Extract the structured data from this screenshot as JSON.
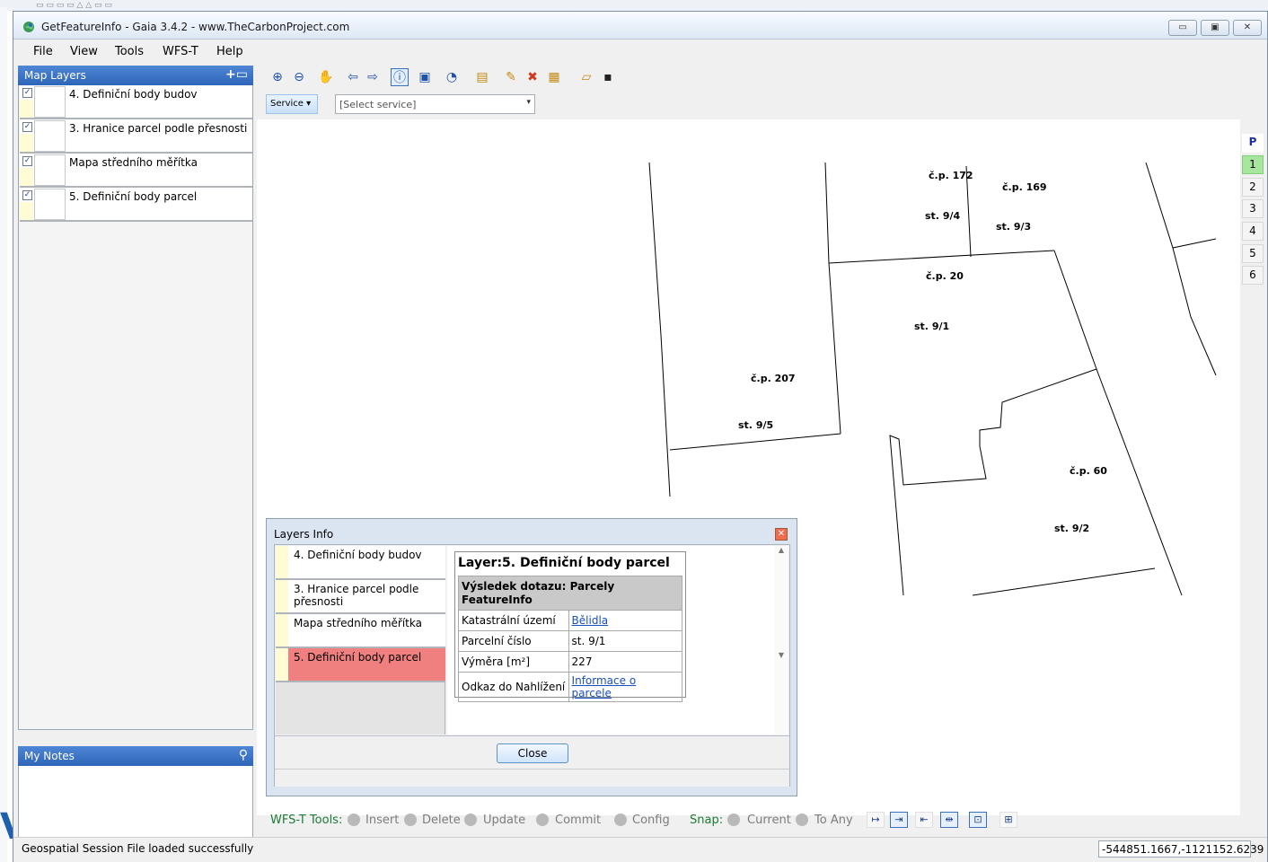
{
  "window": {
    "title": "GetFeatureInfo - Gaia 3.4.2 - www.TheCarbonProject.com",
    "controls": {
      "minimize": "▭",
      "maximize": "▣",
      "close": "✕"
    }
  },
  "menu": [
    "File",
    "View",
    "Tools",
    "WFS-T",
    "Help"
  ],
  "map_layers": {
    "title": "Map Layers",
    "add_icon": "add-layer-icon",
    "items": [
      {
        "label": "4. Definiční body budov",
        "checked": true
      },
      {
        "label": "3. Hranice parcel podle přesnosti",
        "checked": true
      },
      {
        "label": "Mapa středního měřítka",
        "checked": true
      },
      {
        "label": "5. Definiční body parcel",
        "checked": true
      }
    ]
  },
  "notes": {
    "title": "My Notes",
    "icon": "pin-icon"
  },
  "toolbar": {
    "icons": [
      "zoom-in-icon",
      "zoom-out-icon",
      "pan-hand-icon",
      "back-arrow-icon",
      "forward-arrow-icon",
      "info-icon",
      "full-extent-icon",
      "refresh-icon",
      "open-file-icon",
      "edit-icon",
      "delete-icon",
      "edit-label-icon",
      "folder-open-icon",
      "save-icon"
    ],
    "service_label": "Service ▾",
    "service_placeholder": "[Select service]"
  },
  "map": {
    "labels": [
      "č.p. 172",
      "č.p. 169",
      "st. 9/4",
      "st. 9/3",
      "č.p. 20",
      "st. 9/1",
      "č.p. 207",
      "st. 9/5",
      "č.p. 60",
      "st. 9/2"
    ]
  },
  "scale_levels": [
    "P",
    "1",
    "2",
    "3",
    "4",
    "5",
    "6"
  ],
  "scale_active": "1",
  "layers_info": {
    "title": "Layers Info",
    "layers": [
      "4. Definiční body budov",
      "3. Hranice parcel podle přesnosti",
      "Mapa středního měřítka",
      "5. Definiční body parcel"
    ],
    "selected_layer": "5. Definiční body parcel",
    "heading": "Layer:5. Definiční body parcel",
    "caption": "Výsledek dotazu: Parcely FeatureInfo",
    "rows": [
      {
        "key": "Katastrální území",
        "value": "Bělidla",
        "link": true
      },
      {
        "key": "Parcelní číslo",
        "value": "st. 9/1",
        "link": false
      },
      {
        "key": "Výměra [m²]",
        "value": "227",
        "link": false
      },
      {
        "key": "Odkaz do Nahlížení",
        "value": "Informace o parcele",
        "link": true
      }
    ],
    "close_label": "Close"
  },
  "wfs": {
    "label": "WFS-T Tools:",
    "items": [
      "Insert",
      "Delete",
      "Update",
      "Commit",
      "Config"
    ],
    "snap_label": "Snap:",
    "snap_items": [
      "Current",
      "To Any"
    ]
  },
  "status": {
    "message": "Geospatial Session File loaded successfully",
    "coords": "-544851.1667,-1121152.6239"
  }
}
